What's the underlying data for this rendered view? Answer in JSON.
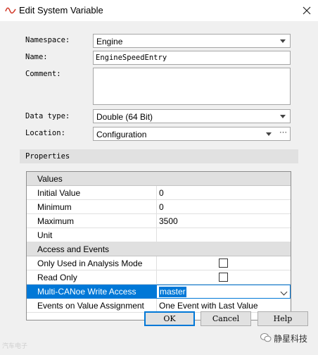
{
  "window": {
    "title": "Edit System Variable"
  },
  "form": {
    "namespace_label": "Namespace:",
    "namespace_value": "Engine",
    "name_label": "Name:",
    "name_value": "EngineSpeedEntry",
    "comment_label": "Comment:",
    "comment_value": "",
    "datatype_label": "Data type:",
    "datatype_value": "Double (64 Bit)",
    "location_label": "Location:",
    "location_value": "Configuration",
    "location_browse": "···"
  },
  "properties": {
    "header": "Properties",
    "groups": {
      "values": "Values",
      "access": "Access and Events"
    },
    "rows": {
      "initial_value": {
        "name": "Initial Value",
        "value": "0"
      },
      "minimum": {
        "name": "Minimum",
        "value": "0"
      },
      "maximum": {
        "name": "Maximum",
        "value": "3500"
      },
      "unit": {
        "name": "Unit",
        "value": ""
      },
      "analysis_mode": {
        "name": "Only Used in Analysis Mode",
        "checked": false
      },
      "read_only": {
        "name": "Read Only",
        "checked": false
      },
      "write_access": {
        "name": "Multi-CANoe Write Access",
        "value": "master"
      },
      "events": {
        "name": "Events on Value Assignment",
        "value": "One Event with Last Value"
      }
    }
  },
  "buttons": {
    "ok": "OK",
    "cancel": "Cancel",
    "help": "Help"
  },
  "watermark": {
    "left": "汽车电子",
    "right": "静星科技"
  },
  "colors": {
    "selection": "#0078d7",
    "dialog_bg": "#f0f0f0",
    "group_bg": "#e0e0e0"
  }
}
